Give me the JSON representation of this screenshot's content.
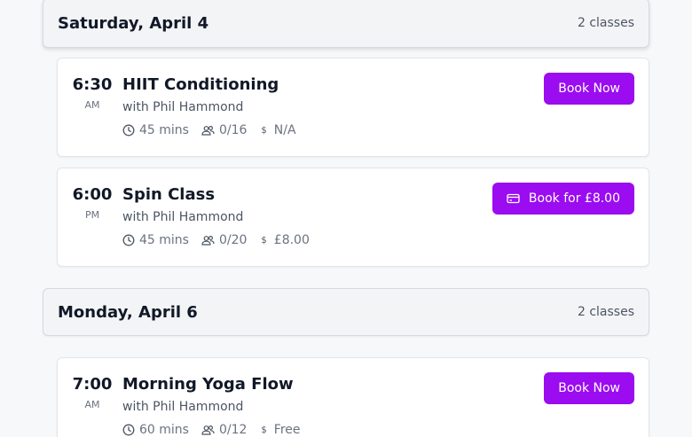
{
  "colors": {
    "accent": "#9b0cf0",
    "header_bg": "#f3f4f6",
    "card_bg": "#ffffff"
  },
  "days": [
    {
      "title": "Saturday, April 4",
      "count": "2 classes",
      "classes": [
        {
          "time": "6:30",
          "ampm": "AM",
          "name": "HIIT Conditioning",
          "instructor": "with Phil Hammond",
          "duration": "45 mins",
          "capacity": "0/16",
          "price": "N/A",
          "button": "Book Now",
          "button_icon": ""
        },
        {
          "time": "6:00",
          "ampm": "PM",
          "name": "Spin Class",
          "instructor": "with Phil Hammond",
          "duration": "45 mins",
          "capacity": "0/20",
          "price": "£8.00",
          "button": "Book for £8.00",
          "button_icon": "credit-card-icon"
        }
      ]
    },
    {
      "title": "Monday, April 6",
      "count": "2 classes",
      "classes": [
        {
          "time": "7:00",
          "ampm": "AM",
          "name": "Morning Yoga Flow",
          "instructor": "with Phil Hammond",
          "duration": "60 mins",
          "capacity": "0/12",
          "price": "Free",
          "button": "Book Now",
          "button_icon": ""
        }
      ]
    }
  ]
}
